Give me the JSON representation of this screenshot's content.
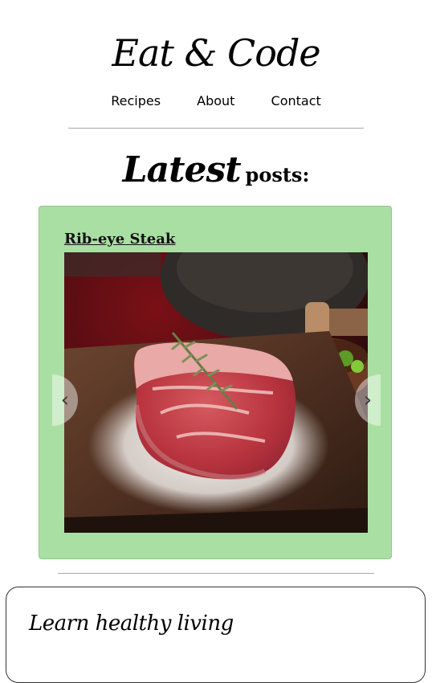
{
  "header": {
    "title": "Eat & Code"
  },
  "nav": {
    "items": [
      {
        "label": "Recipes"
      },
      {
        "label": "About"
      },
      {
        "label": "Contact"
      }
    ]
  },
  "latest": {
    "emphasis": "Latest",
    "rest": "posts:"
  },
  "carousel": {
    "slides": [
      {
        "title": "Rib-eye Steak"
      }
    ],
    "prev_label": "‹",
    "next_label": "›"
  },
  "section": {
    "heading": "Learn healthy living"
  },
  "colors": {
    "card_background": "#aadfa3",
    "rule": "#a8a8a8"
  }
}
